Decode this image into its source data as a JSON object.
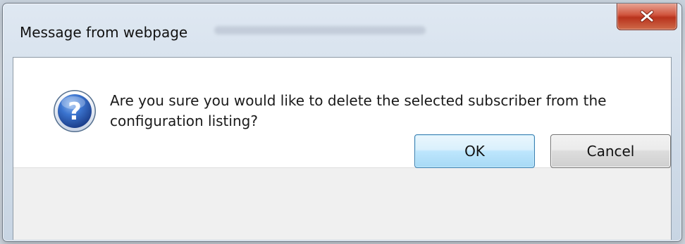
{
  "dialog": {
    "title": "Message from webpage",
    "message": "Are you sure you would like to delete the selected subscriber from the configuration listing?",
    "icon": "question-icon",
    "buttons": {
      "ok_label": "OK",
      "cancel_label": "Cancel"
    },
    "close_icon": "close-icon",
    "colors": {
      "close_button": "#c8452d",
      "ok_button_border": "#3c7fb1",
      "question_icon": "#2a5fb4",
      "button_strip": "#f0f0f0"
    }
  }
}
